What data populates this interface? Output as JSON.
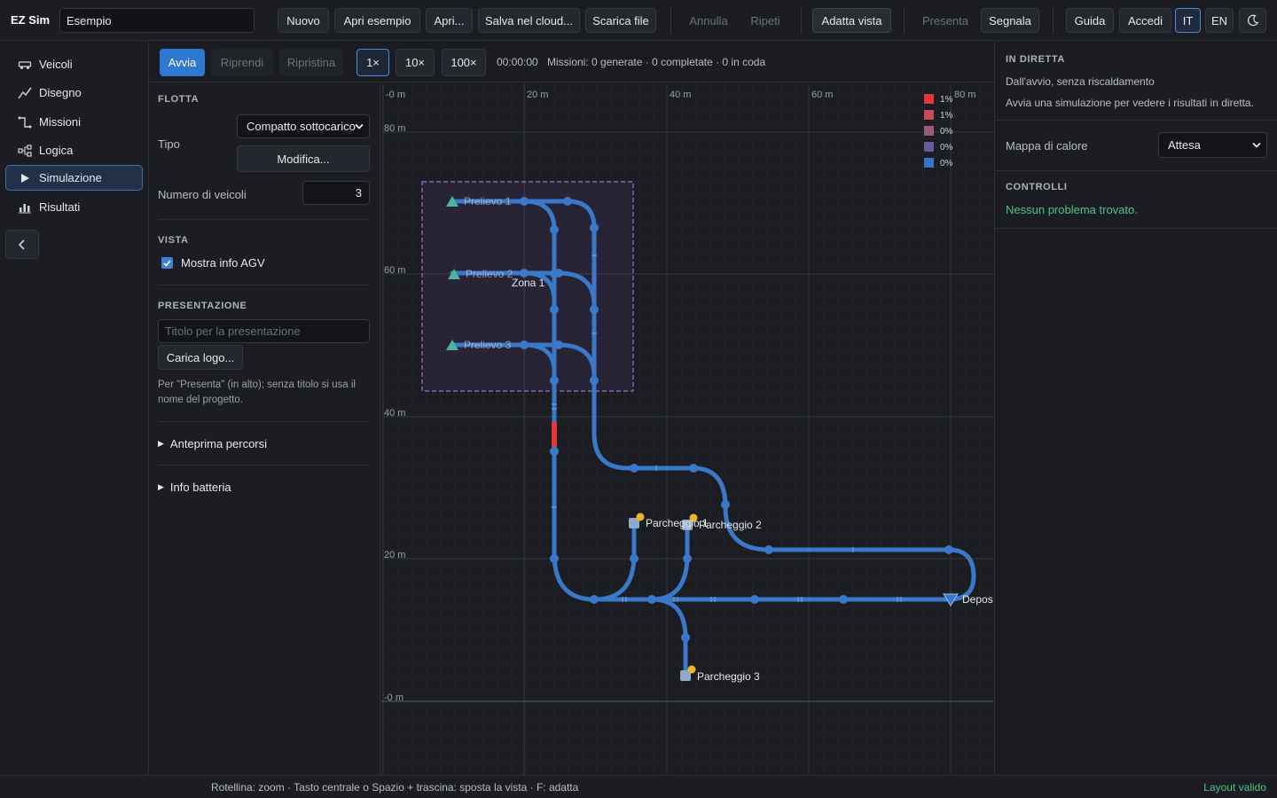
{
  "topbar": {
    "brand": "EZ Sim",
    "project_name": "Esempio",
    "buttons": {
      "new": "Nuovo",
      "open_example": "Apri esempio",
      "open": "Apri...",
      "save_cloud": "Salva nel cloud...",
      "download": "Scarica file",
      "undo": "Annulla",
      "redo": "Ripeti",
      "fit": "Adatta vista",
      "present": "Presenta",
      "report": "Segnala",
      "guide": "Guida",
      "login": "Accedi",
      "lang_it": "IT",
      "lang_en": "EN"
    },
    "theme_icon": "moon-icon"
  },
  "sidebar": {
    "items": [
      {
        "label": "Veicoli",
        "icon": "vehicle-icon"
      },
      {
        "label": "Disegno",
        "icon": "draw-icon"
      },
      {
        "label": "Missioni",
        "icon": "missions-icon"
      },
      {
        "label": "Logica",
        "icon": "logic-icon"
      },
      {
        "label": "Simulazione",
        "icon": "play-icon",
        "active": true
      },
      {
        "label": "Risultati",
        "icon": "results-icon"
      }
    ],
    "collapse_icon": "chevron-left-icon"
  },
  "simbar": {
    "start": "Avvia",
    "resume": "Riprendi",
    "reset": "Ripristina",
    "speed_1": "1×",
    "speed_10": "10×",
    "speed_100": "100×",
    "time": "00:00:00",
    "missions": "Missioni: 0 generate · 0 completate · 0 in coda"
  },
  "config": {
    "fleet_title": "FLOTTA",
    "type_label": "Tipo",
    "type_value": "Compatto sottocarico",
    "edit_button": "Modifica...",
    "count_label": "Numero di veicoli",
    "count_value": "3",
    "view_title": "VISTA",
    "show_agv_label": "Mostra info AGV",
    "show_agv_checked": true,
    "presentation_title": "PRESENTAZIONE",
    "presentation_placeholder": "Titolo per la presentazione",
    "upload_logo": "Carica logo...",
    "presentation_help": "Per \"Presenta\" (in alto); senza titolo si usa il nome del progetto.",
    "route_preview": "Anteprima percorsi",
    "battery_info": "Info batteria"
  },
  "canvas": {
    "x_ticks": [
      {
        "value": 0,
        "label": "-0 m"
      },
      {
        "value": 20,
        "label": "20 m"
      },
      {
        "value": 40,
        "label": "40 m"
      },
      {
        "value": 60,
        "label": "60 m"
      },
      {
        "value": 80,
        "label": "80 m"
      }
    ],
    "y_ticks": [
      {
        "value": 80,
        "label": "80 m"
      },
      {
        "value": 60,
        "label": "60 m"
      },
      {
        "value": 40,
        "label": "40 m"
      },
      {
        "value": 20,
        "label": "20 m"
      },
      {
        "value": 0,
        "label": "-0 m"
      }
    ],
    "zone_label": "Zona 1",
    "stations": [
      {
        "label": "Prelievo 1"
      },
      {
        "label": "Prelievo 2"
      },
      {
        "label": "Prelievo 3"
      },
      {
        "label": "Parcheggio 1"
      },
      {
        "label": "Parcheggio 2"
      },
      {
        "label": "Parcheggio 3"
      },
      {
        "label": "Deposito"
      }
    ],
    "legend": [
      {
        "label": "1%",
        "color": "#e5383b"
      },
      {
        "label": "1%",
        "color": "#c94a5c"
      },
      {
        "label": "0%",
        "color": "#9b5a79"
      },
      {
        "label": "0%",
        "color": "#6a5a9a"
      },
      {
        "label": "0%",
        "color": "#3674c4"
      }
    ],
    "path_color": "#3a78c9",
    "highlight_color": "#e5383b"
  },
  "right_panel": {
    "live_title": "IN DIRETTA",
    "live_subtitle": "Dall'avvio, senza riscaldamento",
    "live_hint": "Avvia una simulazione per vedere i risultati in diretta.",
    "heatmap_label": "Mappa di calore",
    "heatmap_value": "Attesa",
    "checks_title": "CONTROLLI",
    "checks_result": "Nessun problema trovato."
  },
  "statusbar": {
    "hint": "Rotellina: zoom · Tasto centrale o Spazio + trascina: sposta la vista · F: adatta",
    "valid": "Layout valido"
  }
}
